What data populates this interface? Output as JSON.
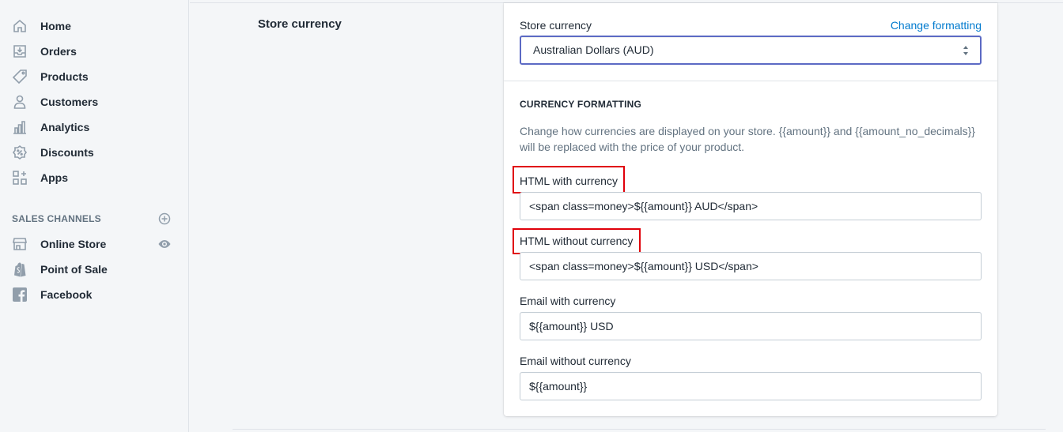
{
  "sidebar": {
    "items": [
      {
        "label": "Home",
        "icon": "home-icon"
      },
      {
        "label": "Orders",
        "icon": "orders-icon"
      },
      {
        "label": "Products",
        "icon": "tag-icon"
      },
      {
        "label": "Customers",
        "icon": "person-icon"
      },
      {
        "label": "Analytics",
        "icon": "bar-chart-icon"
      },
      {
        "label": "Discounts",
        "icon": "discount-icon"
      },
      {
        "label": "Apps",
        "icon": "apps-icon"
      }
    ],
    "channels_heading": "SALES CHANNELS",
    "channels": [
      {
        "label": "Online Store",
        "icon": "store-icon"
      },
      {
        "label": "Point of Sale",
        "icon": "shopify-bag-icon"
      },
      {
        "label": "Facebook",
        "icon": "facebook-icon"
      }
    ]
  },
  "section": {
    "title": "Store currency"
  },
  "card": {
    "currency_label": "Store currency",
    "change_formatting": "Change formatting",
    "currency_value": "Australian Dollars (AUD)",
    "formatting_heading": "CURRENCY FORMATTING",
    "help_text": "Change how currencies are displayed on your store. {{amount}} and {{amount_no_decimals}} will be replaced with the price of your product.",
    "fields": [
      {
        "label": "HTML with currency",
        "value": "<span class=money>${{amount}} AUD</span>"
      },
      {
        "label": "HTML without currency",
        "value": "<span class=money>${{amount}} USD</span>"
      },
      {
        "label": "Email with currency",
        "value": "${{amount}} USD"
      },
      {
        "label": "Email without currency",
        "value": "${{amount}}"
      }
    ]
  },
  "colors": {
    "accent": "#5c6ac4",
    "link": "#007ace",
    "highlight": "#e0000a"
  }
}
